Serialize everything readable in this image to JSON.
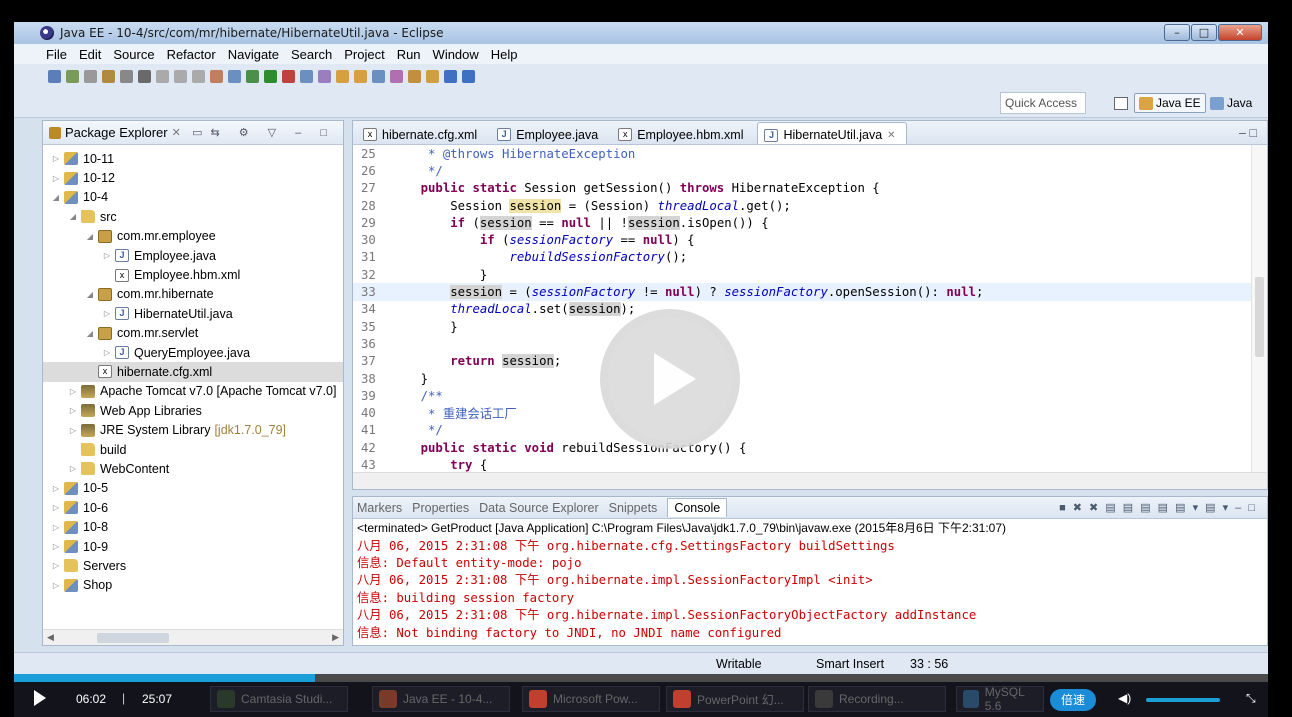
{
  "window": {
    "title": "Java EE - 10-4/src/com/mr/hibernate/HibernateUtil.java - Eclipse"
  },
  "menu": [
    "File",
    "Edit",
    "Source",
    "Refactor",
    "Navigate",
    "Search",
    "Project",
    "Run",
    "Window",
    "Help"
  ],
  "toolbar": {
    "quick_access": "Quick Access",
    "perspective_active": "Java EE",
    "perspective_other": "Java"
  },
  "package_explorer": {
    "title": "Package Explorer",
    "rows": [
      {
        "label": "10-11",
        "indent": 0,
        "tw": "▷",
        "icon": "proj"
      },
      {
        "label": "10-12",
        "indent": 0,
        "tw": "▷",
        "icon": "proj"
      },
      {
        "label": "10-4",
        "indent": 0,
        "tw": "◢",
        "icon": "proj"
      },
      {
        "label": "src",
        "indent": 1,
        "tw": "◢",
        "icon": "fold"
      },
      {
        "label": "com.mr.employee",
        "indent": 2,
        "tw": "◢",
        "icon": "pkg"
      },
      {
        "label": "Employee.java",
        "indent": 3,
        "tw": "▷",
        "icon": "java"
      },
      {
        "label": "Employee.hbm.xml",
        "indent": 3,
        "tw": "",
        "icon": "xml"
      },
      {
        "label": "com.mr.hibernate",
        "indent": 2,
        "tw": "◢",
        "icon": "pkg"
      },
      {
        "label": "HibernateUtil.java",
        "indent": 3,
        "tw": "▷",
        "icon": "java"
      },
      {
        "label": "com.mr.servlet",
        "indent": 2,
        "tw": "◢",
        "icon": "pkg"
      },
      {
        "label": "QueryEmployee.java",
        "indent": 3,
        "tw": "▷",
        "icon": "java"
      },
      {
        "label": "hibernate.cfg.xml",
        "indent": 2,
        "tw": "",
        "icon": "xml",
        "selected": true
      },
      {
        "label": "Apache Tomcat v7.0 [Apache Tomcat v7.0]",
        "indent": 1,
        "tw": "▷",
        "icon": "lib"
      },
      {
        "label": "Web App Libraries",
        "indent": 1,
        "tw": "▷",
        "icon": "lib"
      },
      {
        "label": "JRE System Library",
        "extra": "[jdk1.7.0_79]",
        "indent": 1,
        "tw": "▷",
        "icon": "lib"
      },
      {
        "label": "build",
        "indent": 1,
        "tw": "",
        "icon": "fold"
      },
      {
        "label": "WebContent",
        "indent": 1,
        "tw": "▷",
        "icon": "fold"
      },
      {
        "label": "10-5",
        "indent": 0,
        "tw": "▷",
        "icon": "proj"
      },
      {
        "label": "10-6",
        "indent": 0,
        "tw": "▷",
        "icon": "proj"
      },
      {
        "label": "10-8",
        "indent": 0,
        "tw": "▷",
        "icon": "proj"
      },
      {
        "label": "10-9",
        "indent": 0,
        "tw": "▷",
        "icon": "proj"
      },
      {
        "label": "Servers",
        "indent": 0,
        "tw": "▷",
        "icon": "fold"
      },
      {
        "label": "Shop",
        "indent": 0,
        "tw": "▷",
        "icon": "proj"
      }
    ]
  },
  "editor": {
    "tabs": [
      {
        "label": "hibernate.cfg.xml",
        "icon": "xml"
      },
      {
        "label": "Employee.java",
        "icon": "java"
      },
      {
        "label": "Employee.hbm.xml",
        "icon": "xml"
      },
      {
        "label": "HibernateUtil.java",
        "icon": "java",
        "active": true
      }
    ],
    "lines": [
      {
        "n": "25",
        "segs": [
          [
            "     * ",
            "jd"
          ],
          [
            "@throws HibernateException",
            "jd"
          ]
        ]
      },
      {
        "n": "26",
        "segs": [
          [
            "     */",
            "jd"
          ]
        ]
      },
      {
        "n": "27",
        "segs": [
          [
            "    ",
            ""
          ],
          [
            "public static ",
            "kw"
          ],
          [
            "Session getSession() ",
            ""
          ],
          [
            "throws ",
            "kw"
          ],
          [
            "HibernateException {",
            ""
          ]
        ]
      },
      {
        "n": "28",
        "segs": [
          [
            "        Session ",
            ""
          ],
          [
            "session",
            "occw"
          ],
          [
            " = (Session) ",
            ""
          ],
          [
            "threadLocal",
            "it"
          ],
          [
            ".get();",
            ""
          ]
        ]
      },
      {
        "n": "29",
        "segs": [
          [
            "        ",
            ""
          ],
          [
            "if ",
            "kw"
          ],
          [
            "(",
            ""
          ],
          [
            "session",
            "occ"
          ],
          [
            " == ",
            ""
          ],
          [
            "null",
            "kw"
          ],
          [
            " || !",
            ""
          ],
          [
            "session",
            "occ"
          ],
          [
            ".isOpen()) {",
            ""
          ]
        ]
      },
      {
        "n": "30",
        "segs": [
          [
            "            ",
            ""
          ],
          [
            "if ",
            "kw"
          ],
          [
            "(",
            ""
          ],
          [
            "sessionFactory",
            "it"
          ],
          [
            " == ",
            ""
          ],
          [
            "null",
            "kw"
          ],
          [
            ") {",
            ""
          ]
        ]
      },
      {
        "n": "31",
        "segs": [
          [
            "                ",
            ""
          ],
          [
            "rebuildSessionFactory",
            "it"
          ],
          [
            "();",
            ""
          ]
        ]
      },
      {
        "n": "32",
        "segs": [
          [
            "            }",
            ""
          ]
        ]
      },
      {
        "n": "33",
        "segs": [
          [
            "        ",
            ""
          ],
          [
            "session",
            "occ"
          ],
          [
            " = (",
            ""
          ],
          [
            "sessionFactory",
            "it"
          ],
          [
            " != ",
            ""
          ],
          [
            "null",
            "kw"
          ],
          [
            ") ? ",
            ""
          ],
          [
            "sessionFactory",
            "it"
          ],
          [
            ".openSession(): ",
            ""
          ],
          [
            "null",
            "kw"
          ],
          [
            ";",
            ""
          ]
        ],
        "hl": true
      },
      {
        "n": "34",
        "segs": [
          [
            "        ",
            ""
          ],
          [
            "threadLocal",
            "it"
          ],
          [
            ".set(",
            ""
          ],
          [
            "session",
            "occ"
          ],
          [
            ");",
            ""
          ]
        ]
      },
      {
        "n": "35",
        "segs": [
          [
            "        }",
            ""
          ]
        ]
      },
      {
        "n": "36",
        "segs": []
      },
      {
        "n": "37",
        "segs": [
          [
            "        ",
            ""
          ],
          [
            "return ",
            "kw"
          ],
          [
            "session",
            "occ"
          ],
          [
            ";",
            ""
          ]
        ]
      },
      {
        "n": "38",
        "segs": [
          [
            "    }",
            ""
          ]
        ]
      },
      {
        "n": "39",
        "segs": [
          [
            "    /**",
            "jd"
          ]
        ]
      },
      {
        "n": "40",
        "segs": [
          [
            "     * ",
            "jd"
          ],
          [
            "重建会话工厂",
            "jd"
          ]
        ]
      },
      {
        "n": "41",
        "segs": [
          [
            "     */",
            "jd"
          ]
        ]
      },
      {
        "n": "42",
        "segs": [
          [
            "    ",
            ""
          ],
          [
            "public static void ",
            "kw"
          ],
          [
            "rebuildSessionFactory() {",
            ""
          ]
        ]
      },
      {
        "n": "43",
        "segs": [
          [
            "        ",
            ""
          ],
          [
            "try ",
            "kw"
          ],
          [
            "{",
            ""
          ]
        ]
      }
    ]
  },
  "console": {
    "tabs": [
      "Markers",
      "Properties",
      "Data Source Explorer",
      "Snippets",
      "Console"
    ],
    "header": "<terminated> GetProduct [Java Application] C:\\Program Files\\Java\\jdk1.7.0_79\\bin\\javaw.exe (2015年8月6日 下午2:31:07)",
    "lines": [
      "八月 06, 2015 2:31:08 下午 org.hibernate.cfg.SettingsFactory buildSettings",
      "信息: Default entity-mode: pojo",
      "八月 06, 2015 2:31:08 下午 org.hibernate.impl.SessionFactoryImpl <init>",
      "信息: building session factory",
      "八月 06, 2015 2:31:08 下午 org.hibernate.impl.SessionFactoryObjectFactory addInstance",
      "信息: Not binding factory to JNDI, no JNDI name configured"
    ]
  },
  "statusbar": {
    "writable": "Writable",
    "insert_mode": "Smart Insert",
    "position": "33 : 56"
  },
  "player": {
    "current_time": "06:02",
    "total_time": "25:07",
    "progress": 0.24,
    "speed_label": "倍速",
    "taskbar": [
      "Camtasia Studi...",
      "Java EE - 10-4...",
      "Microsoft Pow...",
      "PowerPoint 幻...",
      "Recording...",
      "MySQL 5.6"
    ]
  }
}
